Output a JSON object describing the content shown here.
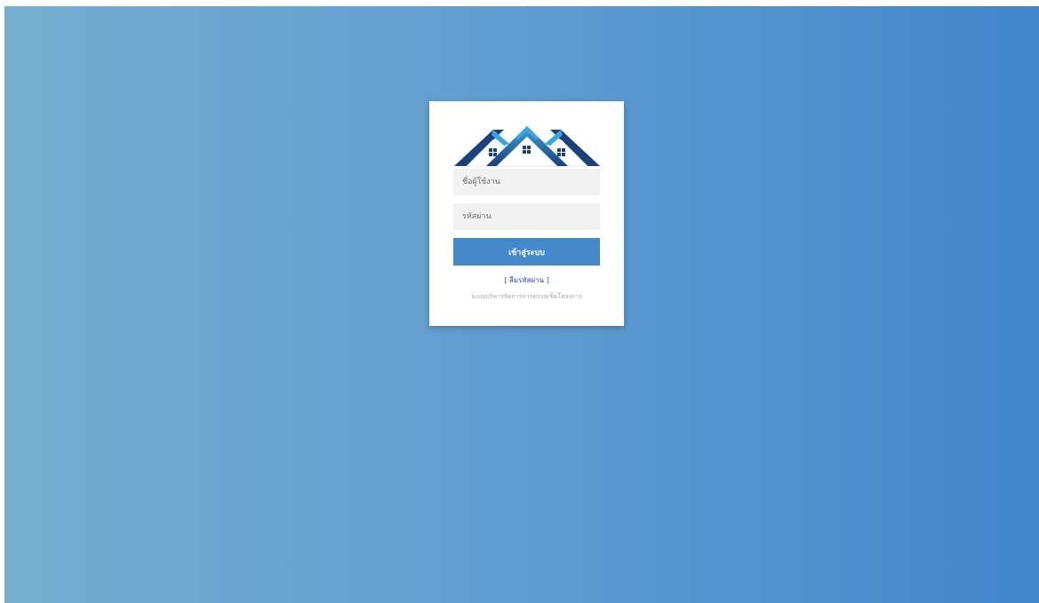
{
  "login": {
    "username_placeholder": "ชื่อผู้ใช้งาน",
    "password_placeholder": "รหัสผ่าน",
    "submit_label": "เข้าสู่ระบบ",
    "forgot_open": "[",
    "forgot_label": "ลืมรหัสผ่าน",
    "forgot_close": "]",
    "subtitle": "ระบบบริหารจัดการการตรวจเช็คโครงการ"
  },
  "colors": {
    "background_start": "#76aed0",
    "background_end": "#4287cb",
    "button": "#4589cb",
    "link": "#2a3fd6",
    "logo_roof_dark": "#1d3f7a",
    "logo_roof_light": "#3aa6e0"
  },
  "icons": {
    "logo": "houses-logo-icon"
  }
}
